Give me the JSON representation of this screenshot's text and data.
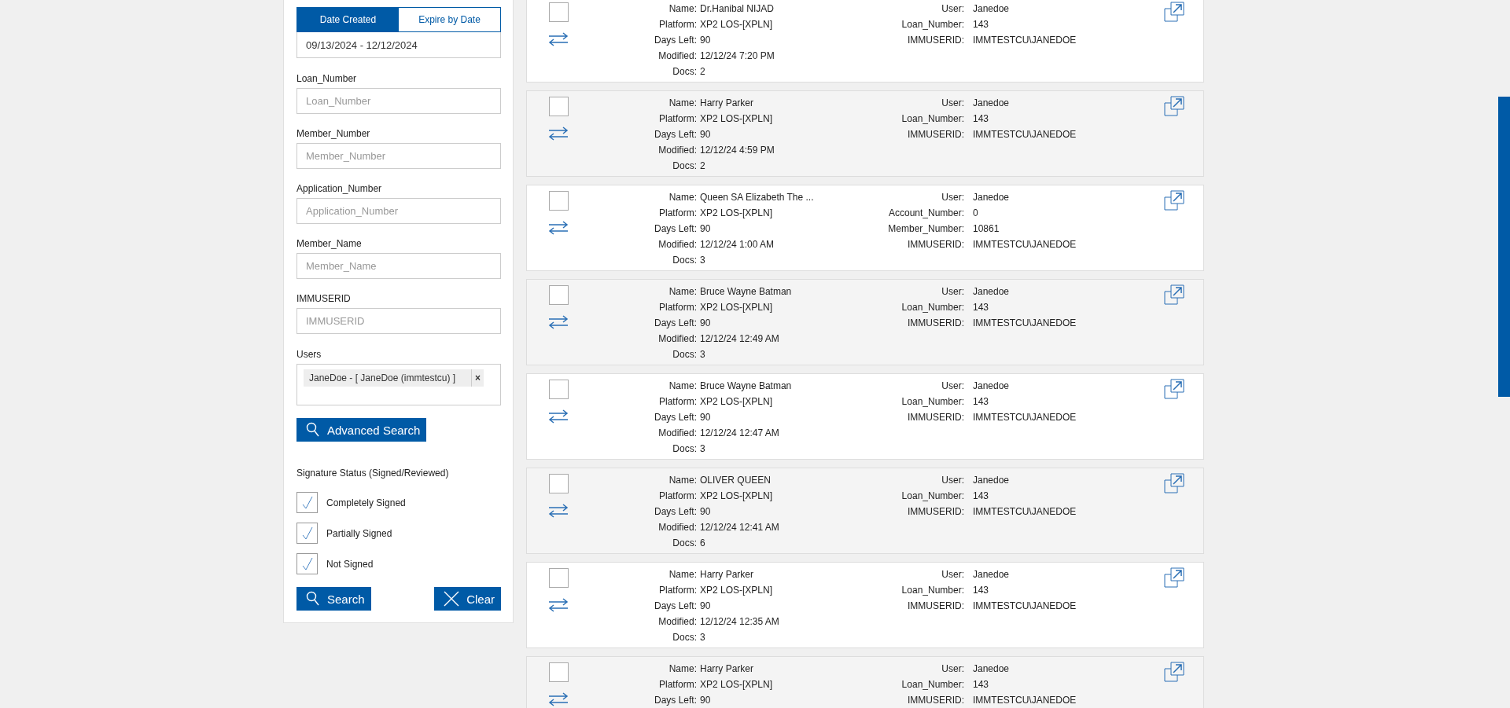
{
  "filter_panel": {
    "date_tabs": [
      {
        "label": "Date Created",
        "selected": true
      },
      {
        "label": "Expire by Date",
        "selected": false
      }
    ],
    "date_range": "09/13/2024 - 12/12/2024",
    "fields": [
      {
        "label": "Loan_Number",
        "placeholder": "Loan_Number"
      },
      {
        "label": "Member_Number",
        "placeholder": "Member_Number"
      },
      {
        "label": "Application_Number",
        "placeholder": "Application_Number"
      },
      {
        "label": "Member_Name",
        "placeholder": "Member_Name"
      },
      {
        "label": "IMMUSERID",
        "placeholder": "IMMUSERID"
      }
    ],
    "users": {
      "label": "Users",
      "tags": [
        {
          "text": "JaneDoe - [ JaneDoe (immtestcu) ]",
          "remove": "×"
        }
      ]
    },
    "advanced_search_button": "Advanced Search",
    "signature_status": {
      "title": "Signature Status (Signed/Reviewed)",
      "options": [
        {
          "label": "Completely Signed",
          "checked": true
        },
        {
          "label": "Partially Signed",
          "checked": true
        },
        {
          "label": "Not Signed",
          "checked": true
        }
      ]
    },
    "search_button": "Search",
    "clear_button": "Clear"
  },
  "results": [
    {
      "checked": false,
      "left": [
        {
          "label": "Name:",
          "value": "Dr.Hanibal NIJAD"
        },
        {
          "label": "Platform:",
          "value": "XP2 LOS-[XPLN]"
        },
        {
          "label": "Days Left:",
          "value": "90"
        },
        {
          "label": "Modified:",
          "value": "12/12/24 7:20 PM"
        },
        {
          "label": "Docs:",
          "value": "2"
        }
      ],
      "right": [
        {
          "label": "User:",
          "value": "Janedoe"
        },
        {
          "label": "Loan_Number:",
          "value": "143"
        },
        {
          "label": "IMMUSERID:",
          "value": "IMMTESTCU\\JANEDOE"
        }
      ]
    },
    {
      "checked": false,
      "left": [
        {
          "label": "Name:",
          "value": "Harry Parker"
        },
        {
          "label": "Platform:",
          "value": "XP2 LOS-[XPLN]"
        },
        {
          "label": "Days Left:",
          "value": "90"
        },
        {
          "label": "Modified:",
          "value": "12/12/24 4:59 PM"
        },
        {
          "label": "Docs:",
          "value": "2"
        }
      ],
      "right": [
        {
          "label": "User:",
          "value": "Janedoe"
        },
        {
          "label": "Loan_Number:",
          "value": "143"
        },
        {
          "label": "IMMUSERID:",
          "value": "IMMTESTCU\\JANEDOE"
        }
      ]
    },
    {
      "checked": false,
      "left": [
        {
          "label": "Name:",
          "value": "Queen SA Elizabeth The ..."
        },
        {
          "label": "Platform:",
          "value": "XP2 LOS-[XPLN]"
        },
        {
          "label": "Days Left:",
          "value": "90"
        },
        {
          "label": "Modified:",
          "value": "12/12/24 1:00 AM"
        },
        {
          "label": "Docs:",
          "value": "3"
        }
      ],
      "right": [
        {
          "label": "User:",
          "value": "Janedoe"
        },
        {
          "label": "Account_Number:",
          "value": "0"
        },
        {
          "label": "Member_Number:",
          "value": "10861"
        },
        {
          "label": "IMMUSERID:",
          "value": "IMMTESTCU\\JANEDOE"
        }
      ]
    },
    {
      "checked": false,
      "left": [
        {
          "label": "Name:",
          "value": "Bruce Wayne Batman"
        },
        {
          "label": "Platform:",
          "value": "XP2 LOS-[XPLN]"
        },
        {
          "label": "Days Left:",
          "value": "90"
        },
        {
          "label": "Modified:",
          "value": "12/12/24 12:49 AM"
        },
        {
          "label": "Docs:",
          "value": "3"
        }
      ],
      "right": [
        {
          "label": "User:",
          "value": "Janedoe"
        },
        {
          "label": "Loan_Number:",
          "value": "143"
        },
        {
          "label": "IMMUSERID:",
          "value": "IMMTESTCU\\JANEDOE"
        }
      ]
    },
    {
      "checked": false,
      "left": [
        {
          "label": "Name:",
          "value": "Bruce Wayne Batman"
        },
        {
          "label": "Platform:",
          "value": "XP2 LOS-[XPLN]"
        },
        {
          "label": "Days Left:",
          "value": "90"
        },
        {
          "label": "Modified:",
          "value": "12/12/24 12:47 AM"
        },
        {
          "label": "Docs:",
          "value": "3"
        }
      ],
      "right": [
        {
          "label": "User:",
          "value": "Janedoe"
        },
        {
          "label": "Loan_Number:",
          "value": "143"
        },
        {
          "label": "IMMUSERID:",
          "value": "IMMTESTCU\\JANEDOE"
        }
      ]
    },
    {
      "checked": false,
      "left": [
        {
          "label": "Name:",
          "value": "OLIVER QUEEN"
        },
        {
          "label": "Platform:",
          "value": "XP2 LOS-[XPLN]"
        },
        {
          "label": "Days Left:",
          "value": "90"
        },
        {
          "label": "Modified:",
          "value": "12/12/24 12:41 AM"
        },
        {
          "label": "Docs:",
          "value": "6"
        }
      ],
      "right": [
        {
          "label": "User:",
          "value": "Janedoe"
        },
        {
          "label": "Loan_Number:",
          "value": "143"
        },
        {
          "label": "IMMUSERID:",
          "value": "IMMTESTCU\\JANEDOE"
        }
      ]
    },
    {
      "checked": false,
      "left": [
        {
          "label": "Name:",
          "value": "Harry Parker"
        },
        {
          "label": "Platform:",
          "value": "XP2 LOS-[XPLN]"
        },
        {
          "label": "Days Left:",
          "value": "90"
        },
        {
          "label": "Modified:",
          "value": "12/12/24 12:35 AM"
        },
        {
          "label": "Docs:",
          "value": "3"
        }
      ],
      "right": [
        {
          "label": "User:",
          "value": "Janedoe"
        },
        {
          "label": "Loan_Number:",
          "value": "143"
        },
        {
          "label": "IMMUSERID:",
          "value": "IMMTESTCU\\JANEDOE"
        }
      ]
    },
    {
      "checked": false,
      "left": [
        {
          "label": "Name:",
          "value": "Harry Parker"
        },
        {
          "label": "Platform:",
          "value": "XP2 LOS-[XPLN]"
        },
        {
          "label": "Days Left:",
          "value": "90"
        }
      ],
      "right": [
        {
          "label": "User:",
          "value": "Janedoe"
        },
        {
          "label": "Loan_Number:",
          "value": "143"
        },
        {
          "label": "IMMUSERID:",
          "value": "IMMTESTCU\\JANEDOE"
        }
      ]
    }
  ]
}
